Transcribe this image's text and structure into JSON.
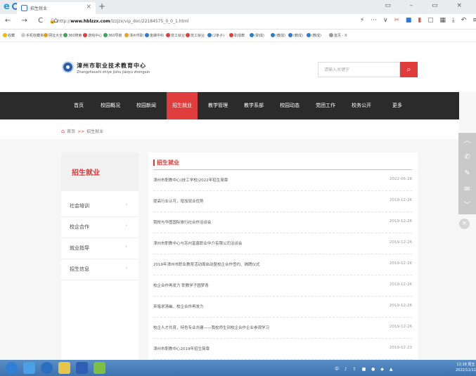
{
  "browser": {
    "tab_title": "招生就业",
    "tab_close": "×",
    "new_tab": "+",
    "nav_buttons": "← → C ⌂",
    "url_prefix": "http://",
    "url_host": "www.hblzzx.com",
    "url_path": "/lzzjzx/vip_doc/22184575_0_0_1.html",
    "window_controls": "▭ – ▭ ×",
    "bookmarks": [
      {
        "label": "收藏",
        "color": "#f5b400"
      },
      {
        "label": "手机收藏夹",
        "color": "#cccccc"
      },
      {
        "label": "网址大全",
        "color": "#e89a1c"
      },
      {
        "label": "360搜索",
        "color": "#3aa757"
      },
      {
        "label": "游戏中心",
        "color": "#e03e3e"
      },
      {
        "label": "360导航",
        "color": "#3aa757"
      },
      {
        "label": "漳州市职",
        "color": "#f0a020"
      },
      {
        "label": "金蝶中科",
        "color": "#2a7ad8"
      },
      {
        "label": "技工就业",
        "color": "#e03e3e"
      },
      {
        "label": "技工就业",
        "color": "#e03e3e"
      },
      {
        "label": "(2条子)",
        "color": "#2a7ad8"
      },
      {
        "label": "职成教",
        "color": "#e03e3e"
      },
      {
        "label": "(职成)",
        "color": "#2a7ad8"
      },
      {
        "label": "(教成)",
        "color": "#2a7ad8"
      },
      {
        "label": "(教成)",
        "color": "#2a7ad8"
      },
      {
        "label": "(教成)",
        "color": "#2a7ad8"
      },
      {
        "label": "首页 - X",
        "color": "#999999"
      }
    ]
  },
  "site": {
    "name_cn": "漳州市职业技术教育中心",
    "name_pinyin": "Zhangzhoushi zhiye jishu jiaoyu zhongxin",
    "search_placeholder": "请输入关键字",
    "search_icon": "search-icon",
    "nav": [
      "首页",
      "校园概况",
      "校园新闻",
      "招生就业",
      "教学管理",
      "教学系部",
      "校园动态",
      "党团工作",
      "校务公开",
      "更多"
    ],
    "nav_active": "招生就业",
    "breadcrumb": {
      "home": "首页",
      "sep": ">>",
      "current": "招生就业"
    }
  },
  "sidebar": {
    "title": "招生就业",
    "items": [
      "社会培训",
      "校企合作",
      "就业指导",
      "招生信息"
    ]
  },
  "main": {
    "section_title": "招生就业",
    "news": [
      {
        "title": "漳州市职教中心(技工学校)2022年招生简章",
        "date": "2022-06-28"
      },
      {
        "title": "提高行业认可，增加就业优势",
        "date": "2019-12-26"
      },
      {
        "title": "我校与华图国际旅行社合作洽谈会",
        "date": "2019-12-26"
      },
      {
        "title": "漳州市职教中心与苏州富鑫职业中介有限公司洽谈会",
        "date": "2019-12-26"
      },
      {
        "title": "2019年漳州市职业教育活动周启动暨校企合作签约、揭牌仪式",
        "date": "2019-12-26"
      },
      {
        "title": "校企合作再发力 职教学子圆梦青",
        "date": "2019-12-26"
      },
      {
        "title": "弃暗求清幽，校企合作再发力",
        "date": "2019-12-26"
      },
      {
        "title": "校企人才共育，特色专业共建——我校师生到校企合作企业参观学习",
        "date": "2019-12-26"
      },
      {
        "title": "漳州市职教中心2019年招生简章",
        "date": "2019-12-23"
      }
    ]
  },
  "taskbar": {
    "tray": "中 ♪ ⇧ ■ ● ◆ ▲",
    "time": "12:18 周五",
    "date": "2022/11/11"
  }
}
